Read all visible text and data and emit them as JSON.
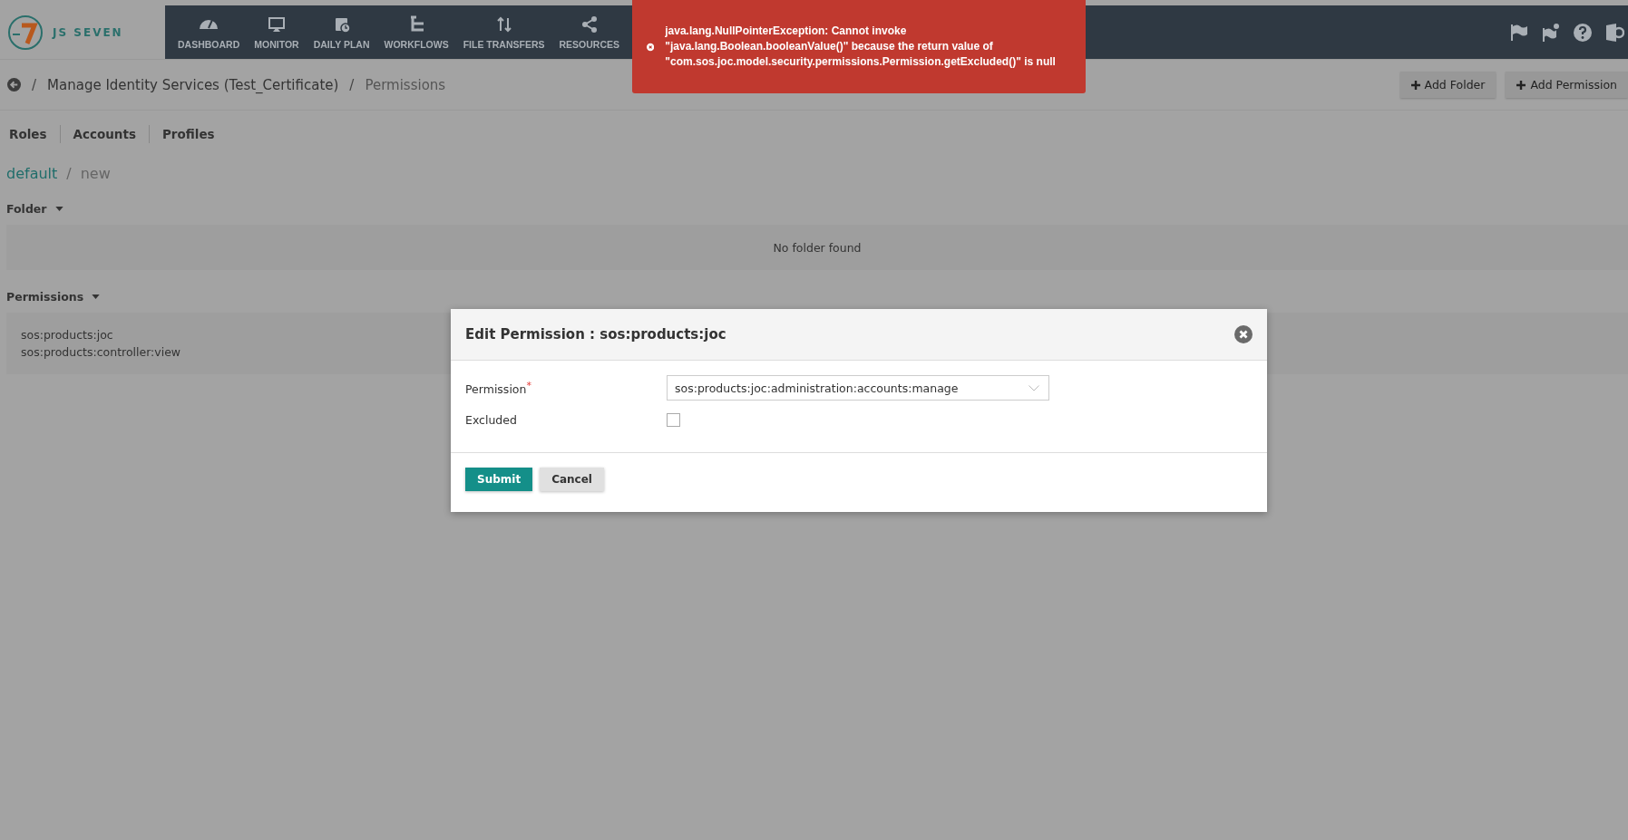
{
  "logo": {
    "text": "JS SEVEN"
  },
  "nav": [
    {
      "label": "DASHBOARD",
      "kind": "gauge"
    },
    {
      "label": "MONITOR",
      "kind": "monitor"
    },
    {
      "label": "DAILY PLAN",
      "kind": "calendar"
    },
    {
      "label": "WORKFLOWS",
      "kind": "tree"
    },
    {
      "label": "FILE TRANSFERS",
      "kind": "arrows"
    },
    {
      "label": "RESOURCES",
      "kind": "share"
    }
  ],
  "header_icons": [
    {
      "kind": "flag"
    },
    {
      "kind": "flag-gear"
    },
    {
      "kind": "help"
    },
    {
      "kind": "user-gear"
    }
  ],
  "toast": {
    "message": "java.lang.NullPointerException: Cannot invoke \"java.lang.Boolean.booleanValue()\" because the return value of \"com.sos.joc.model.security.permissions.Permission.getExcluded()\" is null"
  },
  "breadcrumb": [
    {
      "separator": "/",
      "label": "Manage Identity Services  (Test_Certificate)"
    },
    {
      "separator": "/",
      "label": "Permissions"
    }
  ],
  "actions": [
    "Add Folder",
    "Add Permission"
  ],
  "tabs": [
    {
      "label": "Roles"
    },
    {
      "label": "Accounts"
    },
    {
      "label": "Profiles"
    }
  ],
  "path": [
    {
      "label": "default"
    },
    {
      "separator": "/",
      "label": "new"
    }
  ],
  "folder_section": {
    "title": "Folder",
    "empty_text": "No folder found"
  },
  "permissions_section": {
    "title": "Permissions",
    "items": [
      "sos:products:joc",
      "sos:products:controller:view"
    ]
  },
  "dialog": {
    "title": "Edit Permission : sos:products:joc",
    "permission_label": "Permission",
    "required_mark": "*",
    "permission_value": "sos:products:joc:administration:accounts:manage",
    "excluded_label": "Excluded",
    "excluded": false,
    "buttons": [
      "Submit",
      "Cancel"
    ]
  }
}
